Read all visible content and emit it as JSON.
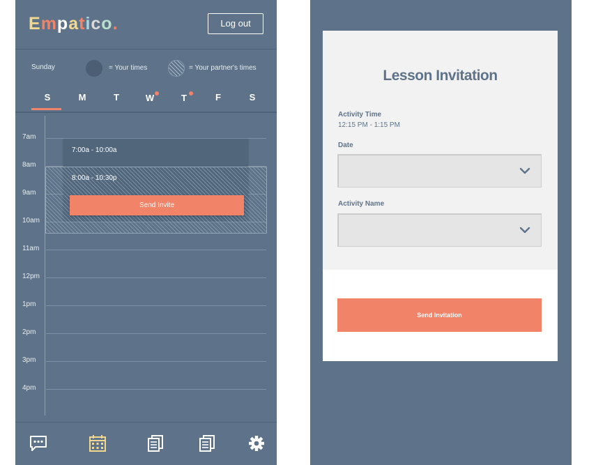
{
  "app": {
    "logo_letters": [
      "E",
      "m",
      "p",
      "a",
      "t",
      "i",
      "c",
      "o",
      "."
    ],
    "logo_colors": [
      "#f3d88f",
      "#f18368",
      "#ffffff",
      "#f3d88f",
      "#f18368",
      "#a8d5e2",
      "#d9d9d9",
      "#b9e0cc",
      "#f18368"
    ],
    "logout_label": "Log out"
  },
  "legend": {
    "day": "Sunday",
    "own": "= Your times",
    "partner": "= Your partner's times"
  },
  "days": [
    {
      "label": "S",
      "dot": false
    },
    {
      "label": "M",
      "dot": false
    },
    {
      "label": "T",
      "dot": false
    },
    {
      "label": "W",
      "dot": true
    },
    {
      "label": "T",
      "dot": true
    },
    {
      "label": "F",
      "dot": false
    },
    {
      "label": "S",
      "dot": false
    }
  ],
  "hours": [
    "7am",
    "8am",
    "9am",
    "10am",
    "11am",
    "12pm",
    "1pm",
    "2pm",
    "3pm",
    "4pm"
  ],
  "schedule": {
    "own_range": "7:00a - 10:00a",
    "partner_range": "8:00a - 10:30p",
    "send_invite_label": "Send Invite"
  },
  "nav": [
    "chat-icon",
    "calendar-icon",
    "document-icon",
    "notes-icon",
    "gear-icon"
  ],
  "colors": {
    "accent": "#f18368",
    "background": "#5e7389",
    "active_nav": "#f3d88f"
  },
  "invitation": {
    "title": "Lesson Invitation",
    "activity_time_label": "Activity Time",
    "activity_time_value": "12:15 PM - 1:15 PM",
    "date_label": "Date",
    "activity_name_label": "Activity Name",
    "submit_label": "Send Invitation"
  }
}
